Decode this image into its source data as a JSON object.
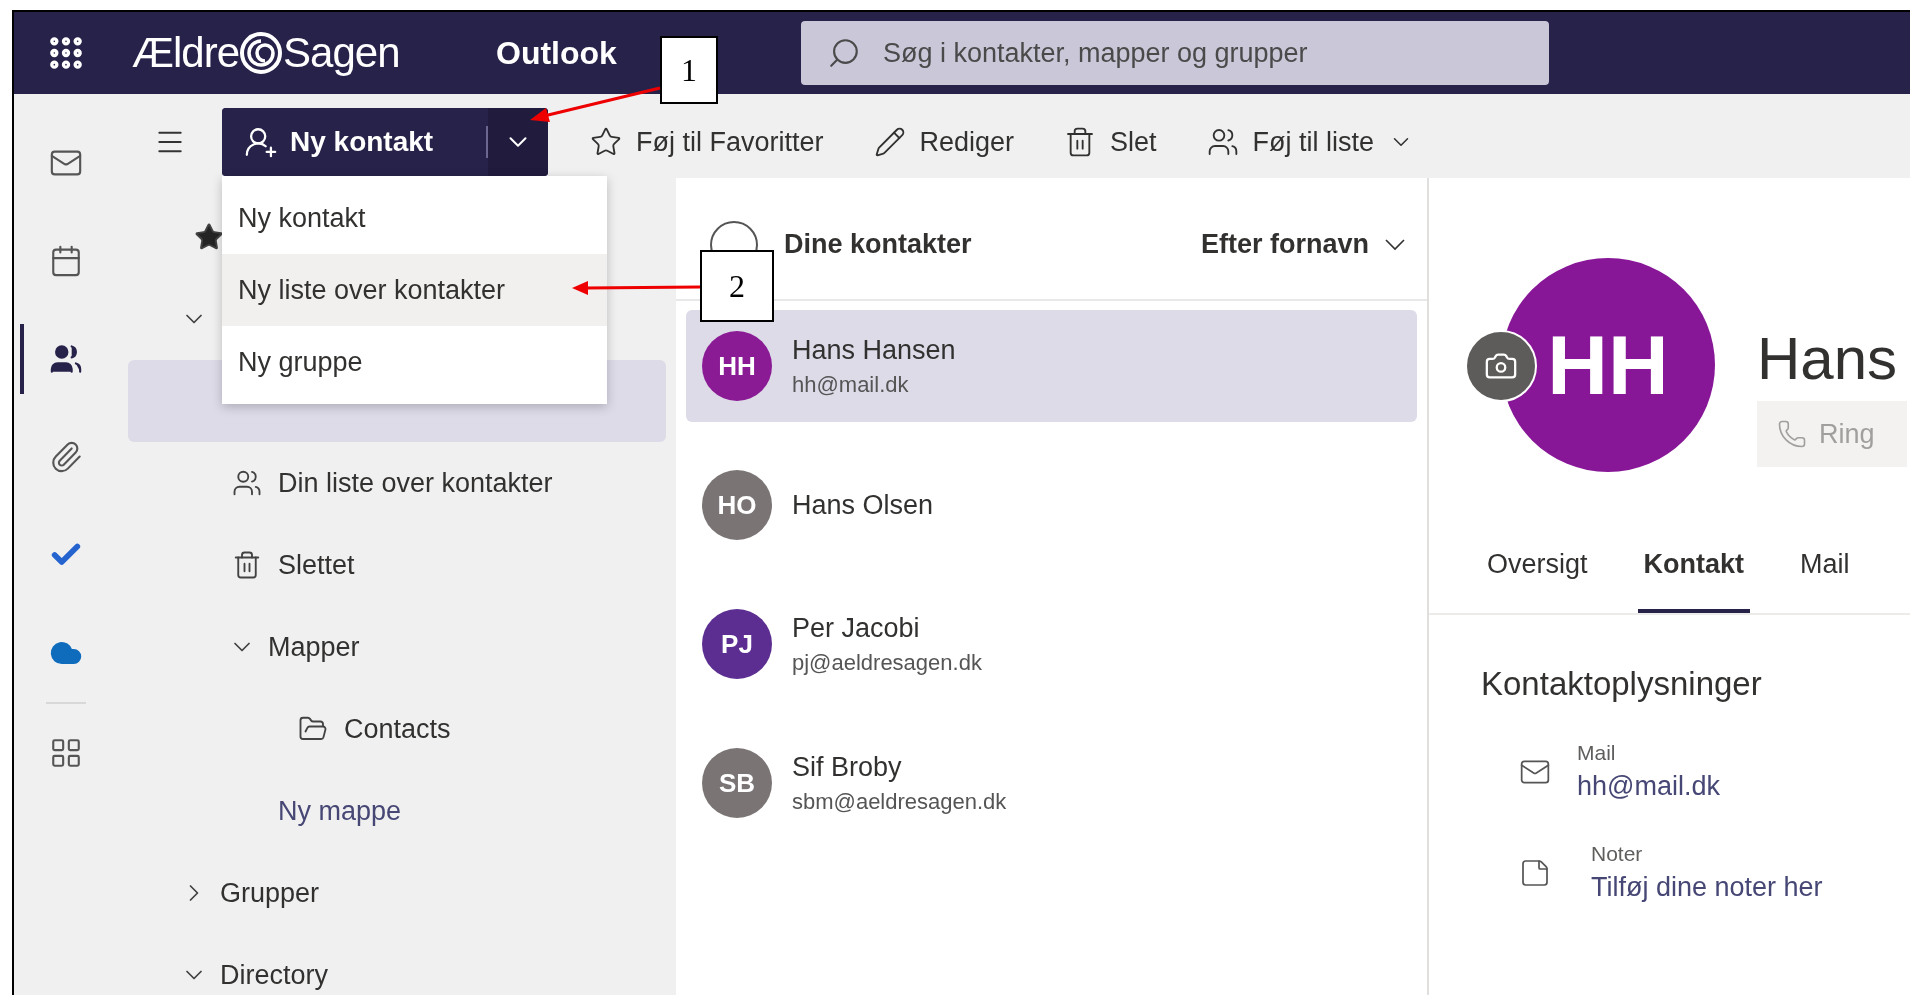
{
  "top_bar": {
    "logo": {
      "before": "Ældre",
      "after": "Sagen"
    },
    "app_name": "Outlook",
    "search": {
      "placeholder": "Søg i kontakter, mapper og grupper"
    }
  },
  "rail": [
    {
      "kind": "mail",
      "selected": false
    },
    {
      "kind": "calendar",
      "selected": false
    },
    {
      "kind": "people",
      "selected": true
    },
    {
      "kind": "files",
      "selected": false
    },
    {
      "kind": "todo",
      "selected": false
    },
    {
      "kind": "cloud",
      "selected": false
    },
    {
      "kind": "apps",
      "selected": false
    }
  ],
  "toolbar": {
    "new_button": {
      "label": "Ny kontakt"
    },
    "actions": [
      {
        "label": "Føj til Favoritter",
        "kind": "favorite",
        "has_menu": false
      },
      {
        "label": "Rediger",
        "kind": "edit",
        "has_menu": false
      },
      {
        "label": "Slet",
        "kind": "delete",
        "has_menu": false
      },
      {
        "label": "Føj til liste",
        "kind": "list",
        "has_menu": true
      }
    ]
  },
  "new_menu": [
    {
      "label": "Ny kontakt",
      "selected": false
    },
    {
      "label": "Ny liste over kontakter",
      "selected": true
    },
    {
      "label": "Ny gruppe",
      "selected": false
    }
  ],
  "folders": [
    {
      "kind": "favorites"
    },
    {
      "kind": "group",
      "expanded": true,
      "children": [
        {
          "kind": "contacts",
          "selected": true
        },
        {
          "kind": "list",
          "label": "Din liste over kontakter",
          "selected": false
        },
        {
          "kind": "deleted",
          "label": "Slettet",
          "selected": false
        },
        {
          "kind": "group",
          "label": "Mapper",
          "expanded": true,
          "children": [
            {
              "kind": "folder",
              "label": "Contacts",
              "selected": false
            },
            {
              "kind": "action",
              "label": "Ny mappe",
              "selected": false
            }
          ]
        }
      ]
    },
    {
      "kind": "group",
      "label": "Grupper",
      "expanded": false
    },
    {
      "kind": "group",
      "label": "Directory",
      "expanded": true
    }
  ],
  "list": {
    "title": "Dine kontakter",
    "sort": "Efter fornavn",
    "contacts": [
      {
        "initials": "HH",
        "name": "Hans Hansen",
        "email": "hh@mail.dk",
        "color": "#8a1b95",
        "selected": true
      },
      {
        "initials": "HO",
        "name": "Hans Olsen",
        "color": "#7a7574",
        "selected": false
      },
      {
        "initials": "PJ",
        "name": "Per Jacobi",
        "email": "pj@aeldresagen.dk",
        "color": "#5c2e91",
        "selected": false
      },
      {
        "initials": "SB",
        "name": "Sif Broby",
        "email": "sbm@aeldresagen.dk",
        "color": "#7a7574",
        "selected": false
      }
    ]
  },
  "detail": {
    "initials": "HH",
    "color": "#881798",
    "name": "Hans",
    "call_button": "Ring",
    "tabs": [
      {
        "label": "Oversigt",
        "selected": false
      },
      {
        "label": "Kontakt",
        "selected": true
      },
      {
        "label": "Mail",
        "selected": false
      }
    ],
    "section_title": "Kontaktoplysninger",
    "fields": [
      {
        "kind": "mail",
        "label": "Mail",
        "value": "hh@mail.dk"
      },
      {
        "kind": "notes",
        "label": "Noter",
        "value": "Tilføj dine noter her"
      }
    ]
  },
  "annotations": [
    {
      "label": "1"
    },
    {
      "label": "2"
    }
  ]
}
